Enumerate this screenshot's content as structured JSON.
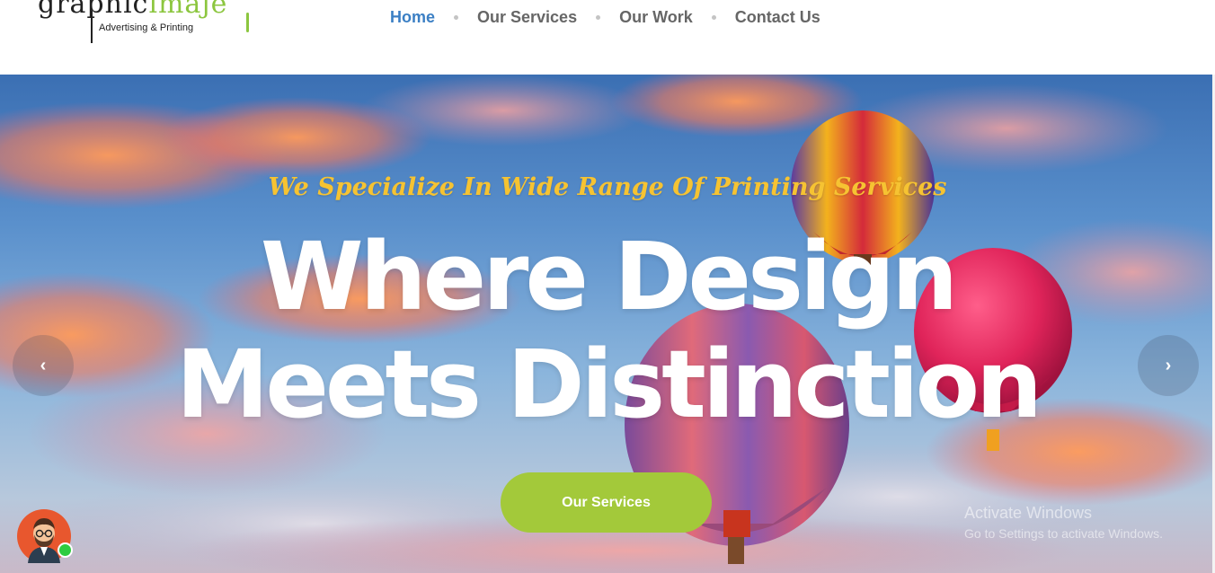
{
  "header": {
    "logo": {
      "word_part1": "graphic",
      "word_part2": "imaje",
      "tagline": "Advertising & Printing"
    },
    "nav": [
      {
        "label": "Home",
        "active": true
      },
      {
        "label": "Our Services",
        "active": false
      },
      {
        "label": "Our Work",
        "active": false
      },
      {
        "label": "Contact Us",
        "active": false
      }
    ]
  },
  "hero": {
    "tagline": "We Specialize In Wide Range Of Printing Services",
    "headline_line1": "Where Design",
    "headline_line2": "Meets Distinction",
    "cta_label": "Our Services",
    "prev_icon": "chevron-left-icon",
    "next_icon": "chevron-right-icon",
    "prev_glyph": "‹",
    "next_glyph": "›"
  },
  "watermark": {
    "line1": "Activate Windows",
    "line2": "Go to Settings to activate Windows."
  },
  "chat_widget": {
    "icon": "avatar-icon",
    "status": "online"
  },
  "colors": {
    "nav_active": "#3b7fc4",
    "nav_text": "#666666",
    "tagline": "#f6c332",
    "cta": "#a3c93a",
    "logo_accent": "#8cc63f",
    "online": "#2ecc40"
  }
}
